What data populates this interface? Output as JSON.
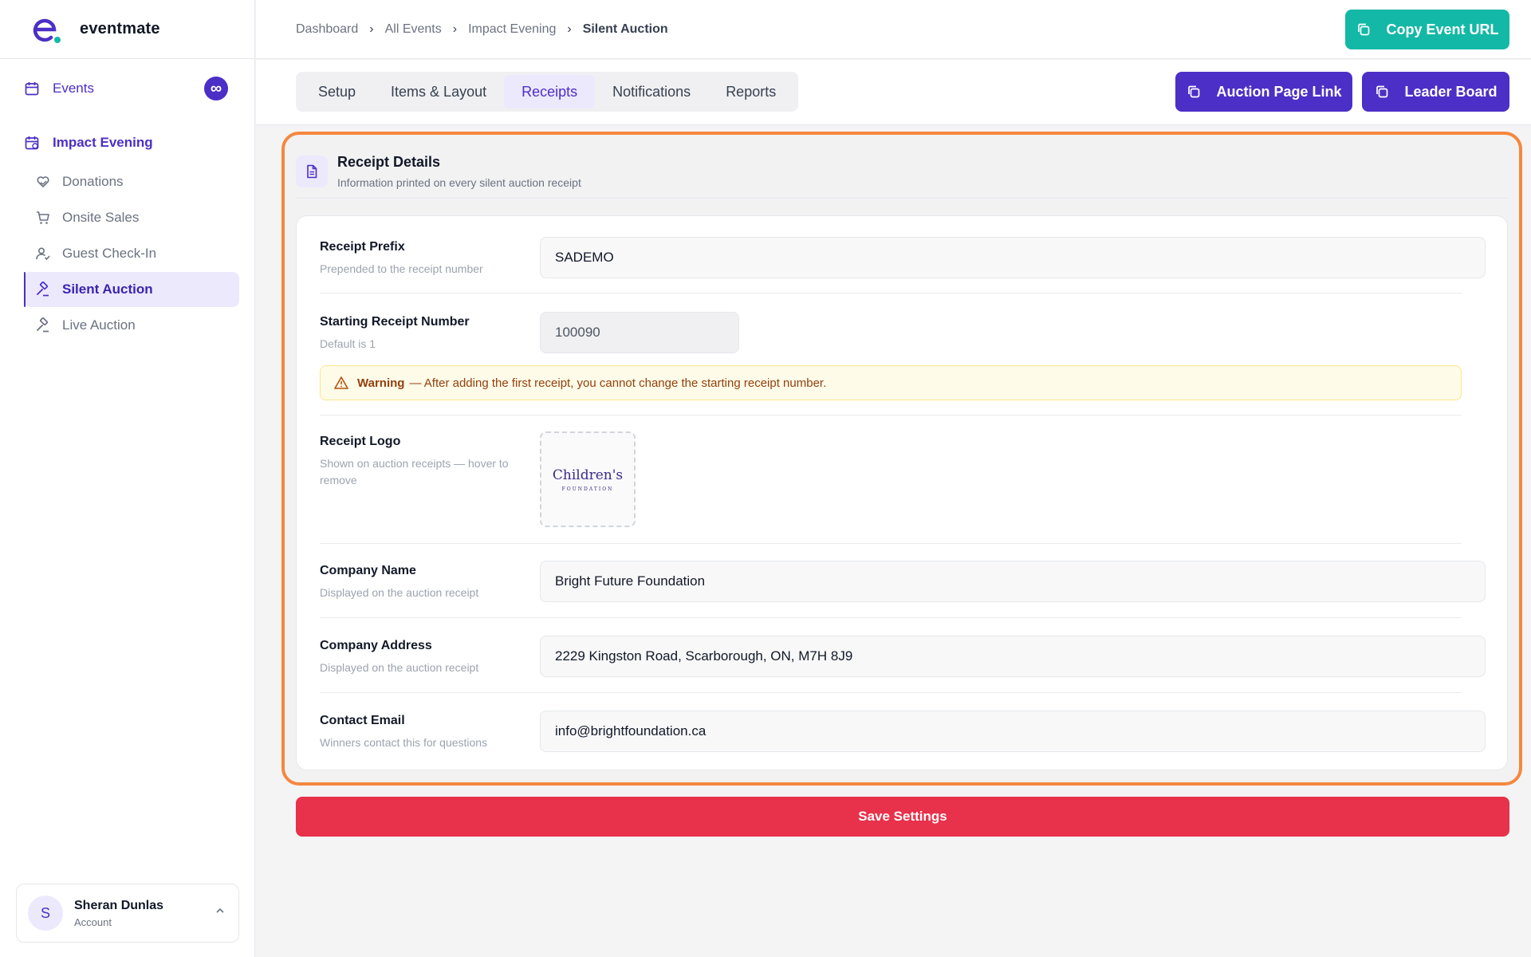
{
  "app": {
    "name": "eventmate"
  },
  "sidebar": {
    "events_label": "Events",
    "events_badge": "∞",
    "section_label": "Impact Evening",
    "items": [
      {
        "label": "Donations",
        "icon": "heart-hand-icon"
      },
      {
        "label": "Onsite Sales",
        "icon": "cart-icon"
      },
      {
        "label": "Guest Check-In",
        "icon": "user-check-icon"
      },
      {
        "label": "Silent Auction",
        "icon": "gavel-icon",
        "active": true
      },
      {
        "label": "Live Auction",
        "icon": "gavel-icon"
      }
    ],
    "account": {
      "initial": "S",
      "name": "Sheran Dunlas",
      "role": "Account"
    }
  },
  "breadcrumb": [
    "Dashboard",
    "All Events",
    "Impact Evening",
    "Silent Auction"
  ],
  "header": {
    "copy_url_label": "Copy Event URL",
    "auction_link_label": "Auction Page Link",
    "leader_board_label": "Leader Board"
  },
  "tabs": [
    "Setup",
    "Items & Layout",
    "Receipts",
    "Notifications",
    "Reports"
  ],
  "active_tab": "Receipts",
  "card": {
    "title": "Receipt Details",
    "subtitle": "Information printed on every silent auction receipt"
  },
  "form": {
    "receipt_prefix": {
      "label": "Receipt Prefix",
      "help": "Prepended to the receipt number",
      "value": "SADEMO"
    },
    "starting_number": {
      "label": "Starting Receipt Number",
      "help": "Default is 1",
      "value": "100090"
    },
    "warning": {
      "strong": "Warning",
      "message": "— After adding the first receipt, you cannot change the starting receipt number."
    },
    "logo": {
      "label": "Receipt Logo",
      "help": "Shown on auction receipts — hover to remove",
      "logo_text": "Children's",
      "logo_sub": "FOUNDATION"
    },
    "company_name": {
      "label": "Company Name",
      "help": "Displayed on the auction receipt",
      "value": "Bright Future Foundation"
    },
    "company_address": {
      "label": "Company Address",
      "help": "Displayed on the auction receipt",
      "value": "2229 Kingston Road, Scarborough, ON, M7H 8J9"
    },
    "contact_email": {
      "label": "Contact Email",
      "help": "Winners contact this for questions",
      "value": "info@brightfoundation.ca"
    }
  },
  "save_label": "Save Settings",
  "colors": {
    "brand": "#4c2fc6",
    "teal": "#14b8a6",
    "save": "#e8314a",
    "highlight": "#f5883e"
  }
}
